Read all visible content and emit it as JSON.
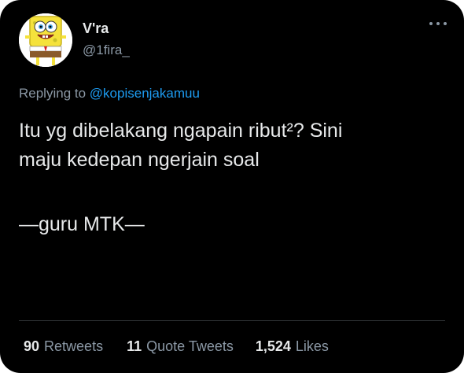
{
  "author": {
    "name": "V'ra",
    "handle": "@1fira_"
  },
  "reply": {
    "prefix": "Replying to",
    "mention": "@kopisenjakamuu"
  },
  "tweet": {
    "line1": "Itu yg dibelakang ngapain ribut²? Sini",
    "line2": "maju kedepan ngerjain soal",
    "signature": "—guru MTK—"
  },
  "stats": {
    "retweets_count": "90",
    "retweets_label": "Retweets",
    "quotes_count": "11",
    "quotes_label": "Quote Tweets",
    "likes_count": "1,524",
    "likes_label": "Likes"
  },
  "colors": {
    "background": "#000000",
    "text": "#e7e9ea",
    "muted": "#8b98a5",
    "link": "#1d9bf0"
  },
  "icons": {
    "more": "more-options-icon"
  }
}
